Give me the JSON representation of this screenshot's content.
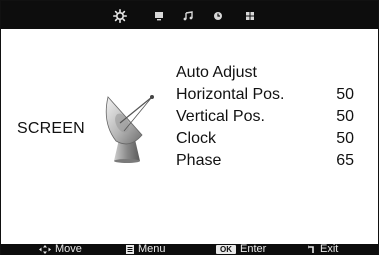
{
  "tabs": [
    {
      "icon": "picture-gear-icon",
      "active": true
    },
    {
      "icon": "monitor-icon",
      "active": false
    },
    {
      "icon": "music-note-icon",
      "active": false
    },
    {
      "icon": "clock-icon",
      "active": false
    },
    {
      "icon": "grid-icon",
      "active": false
    }
  ],
  "section": {
    "title": "SCREEN",
    "icon": "satellite-dish-icon"
  },
  "menu": {
    "items": [
      {
        "label": "Auto Adjust",
        "value": ""
      },
      {
        "label": "Horizontal Pos.",
        "value": "50"
      },
      {
        "label": "Vertical Pos.",
        "value": "50"
      },
      {
        "label": "Clock",
        "value": "50"
      },
      {
        "label": "Phase",
        "value": "65"
      }
    ]
  },
  "footer": {
    "move": "Move",
    "menu": "Menu",
    "ok": "OK",
    "enter": "Enter",
    "exit": "Exit"
  },
  "colors": {
    "bar": "#0d0d0d",
    "text": "#111111",
    "background": "#ffffff"
  }
}
